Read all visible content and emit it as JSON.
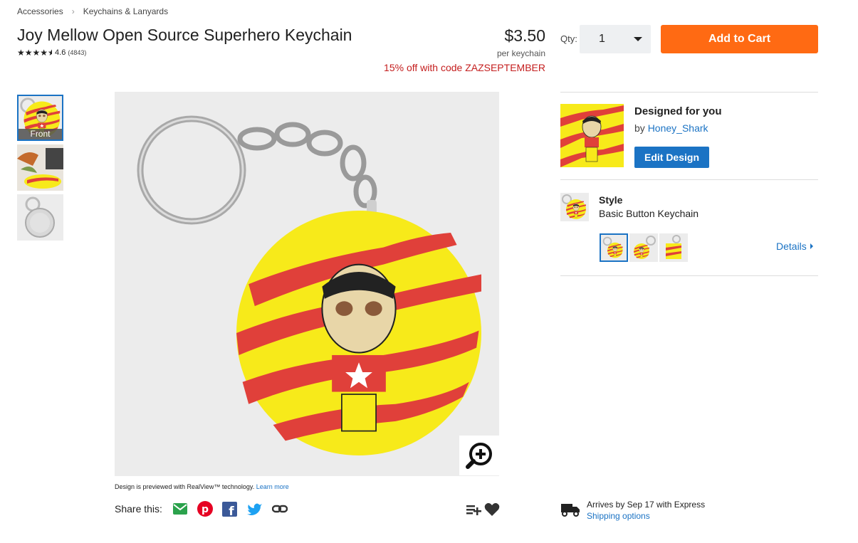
{
  "breadcrumb": {
    "items": [
      "Accessories",
      "Keychains & Lanyards"
    ]
  },
  "product": {
    "title": "Joy Mellow Open Source Superhero Keychain",
    "rating_value": "4.6",
    "rating_count": "(4843)",
    "rating_stars": 4.5,
    "price": "$3.50",
    "per_unit": "per keychain",
    "promo": "15% off with code ZAZSEPTEMBER"
  },
  "purchase": {
    "qty_label": "Qty:",
    "qty_value": "1",
    "add_to_cart": "Add to Cart"
  },
  "thumbnails": [
    {
      "label": "Front",
      "selected": true
    },
    {
      "label": "",
      "selected": false
    },
    {
      "label": "",
      "selected": false
    }
  ],
  "preview": {
    "realview_text": "Design is previewed with RealView™ technology.",
    "learn_more": "Learn more"
  },
  "share": {
    "label": "Share this:",
    "icons": [
      "email-icon",
      "pinterest-icon",
      "facebook-icon",
      "twitter-icon",
      "link-icon"
    ]
  },
  "design": {
    "title": "Designed for you",
    "by_prefix": "by",
    "designer": "Honey_Shark",
    "edit_button": "Edit Design"
  },
  "style": {
    "label": "Style",
    "value": "Basic Button Keychain",
    "details": "Details"
  },
  "shipping": {
    "arrival": "Arrives by Sep 17 with Express",
    "options_link": "Shipping options"
  },
  "colors": {
    "accent_orange": "#ff6a13",
    "link_blue": "#1b73c4",
    "promo_red": "#c41e1e",
    "keychain_yellow": "#f7ea1a",
    "stripe_red": "#e0403a"
  }
}
